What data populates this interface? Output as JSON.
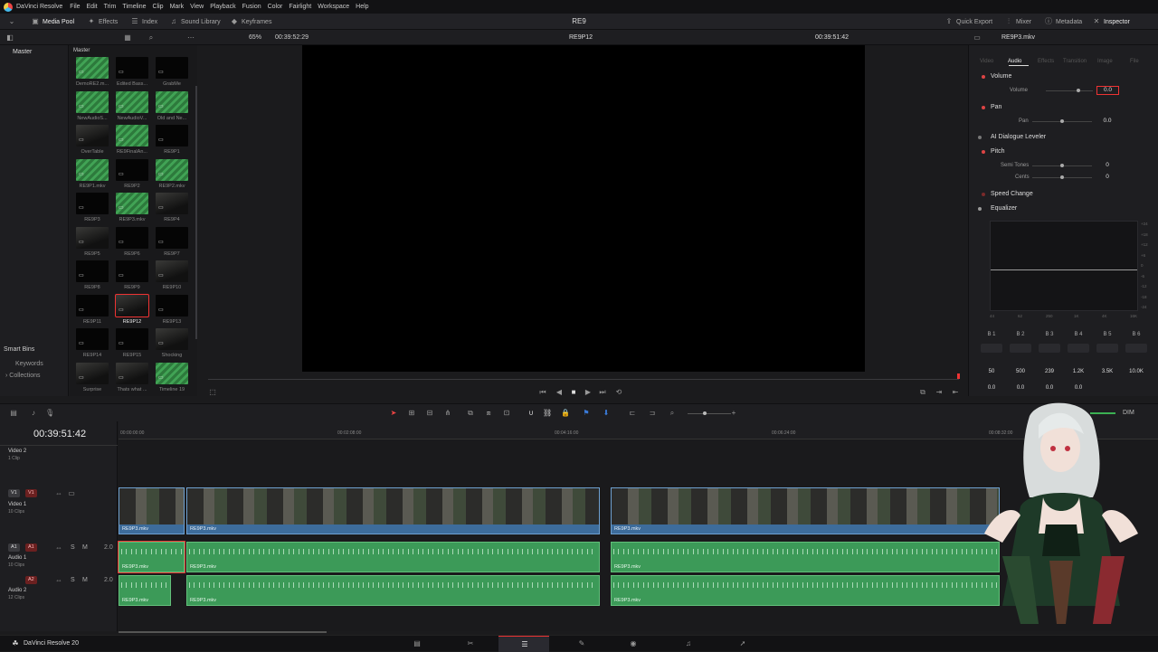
{
  "app": {
    "name": "DaVinci Resolve",
    "project_title": "RE9"
  },
  "menu": [
    "File",
    "Edit",
    "Trim",
    "Timeline",
    "Clip",
    "Mark",
    "View",
    "Playback",
    "Fusion",
    "Color",
    "Fairlight",
    "Workspace",
    "Help"
  ],
  "toolbar": {
    "media_pool": "Media Pool",
    "effects": "Effects",
    "index": "Index",
    "sound_library": "Sound Library",
    "keyframes": "Keyframes",
    "quick_export": "Quick Export",
    "mixer": "Mixer",
    "metadata": "Metadata",
    "inspector": "Inspector"
  },
  "subbar": {
    "zoom": "65%",
    "source_timecode": "00:39:52:29",
    "timeline_name": "RE9P12",
    "record_timecode": "00:39:51:42",
    "inspector_clip": "RE9P3.mkv"
  },
  "bins": {
    "master": "Master",
    "pool_header": "Master",
    "smart_bins": "Smart Bins",
    "keywords": "Keywords",
    "collections": "Collections"
  },
  "clips": [
    {
      "label": "DemoRE2.m...",
      "style": "green"
    },
    {
      "label": "Edited Bass...",
      "style": "black"
    },
    {
      "label": "GrabMe",
      "style": "black"
    },
    {
      "label": "NewAudioS...",
      "style": "green"
    },
    {
      "label": "NewAudioV...",
      "style": "green"
    },
    {
      "label": "Old and Ne...",
      "style": "green"
    },
    {
      "label": "OverTable",
      "style": "dark"
    },
    {
      "label": "RE9FinalAn...",
      "style": "green"
    },
    {
      "label": "RE9P1",
      "style": "black"
    },
    {
      "label": "RE9P1.mkv",
      "style": "green"
    },
    {
      "label": "RE9P2",
      "style": "black"
    },
    {
      "label": "RE9P2.mkv",
      "style": "green"
    },
    {
      "label": "RE9P3",
      "style": "black"
    },
    {
      "label": "RE9P3.mkv",
      "style": "green"
    },
    {
      "label": "RE9P4",
      "style": "dark"
    },
    {
      "label": "RE9P5",
      "style": "dark"
    },
    {
      "label": "RE9P6",
      "style": "black"
    },
    {
      "label": "RE9P7",
      "style": "black"
    },
    {
      "label": "RE9P8",
      "style": "black"
    },
    {
      "label": "RE9P9",
      "style": "black"
    },
    {
      "label": "RE9P10",
      "style": "dark"
    },
    {
      "label": "RE9P11",
      "style": "black"
    },
    {
      "label": "RE9P12",
      "style": "dark",
      "selected": true
    },
    {
      "label": "RE9P13",
      "style": "black"
    },
    {
      "label": "RE9P14",
      "style": "black"
    },
    {
      "label": "RE9P15",
      "style": "black"
    },
    {
      "label": "Shocking",
      "style": "dark"
    },
    {
      "label": "Surprise",
      "style": "dark"
    },
    {
      "label": "Thats what ...",
      "style": "dark"
    },
    {
      "label": "Timeline 19",
      "style": "green"
    }
  ],
  "inspector": {
    "tabs": [
      "Video",
      "Audio",
      "Effects",
      "Transition",
      "Image",
      "File"
    ],
    "active_tab": "Audio",
    "volume": {
      "title": "Volume",
      "param": "Volume",
      "value": "0.0"
    },
    "pan": {
      "title": "Pan",
      "param": "Pan",
      "value": "0.0"
    },
    "ai_dialogue": "AI Dialogue Leveler",
    "pitch": {
      "title": "Pitch",
      "semi_label": "Semi Tones",
      "semi_value": "0",
      "cents_label": "Cents",
      "cents_value": "0"
    },
    "speed_change": "Speed Change",
    "equalizer": "Equalizer",
    "eq_y": [
      "+24",
      "+18",
      "+12",
      "+6",
      "0",
      "-6",
      "-12",
      "-18",
      "-24"
    ],
    "eq_x": [
      "44",
      "62",
      "250",
      "1K",
      "4K",
      "16K"
    ],
    "bands": [
      "B 1",
      "B 2",
      "B 3",
      "B 4",
      "B 5",
      "B 6"
    ],
    "freqs": [
      "50",
      "500",
      "239",
      "1.2K",
      "3.5K",
      "10.0K"
    ],
    "gains": [
      "0.0",
      "0.0",
      "0.0",
      "0.0"
    ]
  },
  "timeline": {
    "timecode": "00:39:51:42",
    "ruler": [
      "00:00:00:00",
      "00:02:08:00",
      "00:04:16:00",
      "00:06:24:00",
      "00:08:32:00"
    ],
    "dim_label": "DIM",
    "tracks": {
      "v2": {
        "name": "Video 2",
        "sub": "1 Clip"
      },
      "v1": {
        "badge1": "V1",
        "badge2": "V1",
        "name": "Video 1",
        "sub": "10 Clips"
      },
      "a1": {
        "badge1": "A1",
        "badge2": "A1",
        "name": "Audio 1",
        "sub": "10 Clips",
        "level": "2.0",
        "s": "S",
        "m": "M"
      },
      "a2": {
        "badge2": "A2",
        "name": "Audio 2",
        "sub": "12 Clips",
        "level": "2.0",
        "s": "S",
        "m": "M"
      }
    },
    "clip_name": "RE9P3.mkv"
  },
  "status": {
    "app_version": "DaVinci Resolve 20"
  }
}
